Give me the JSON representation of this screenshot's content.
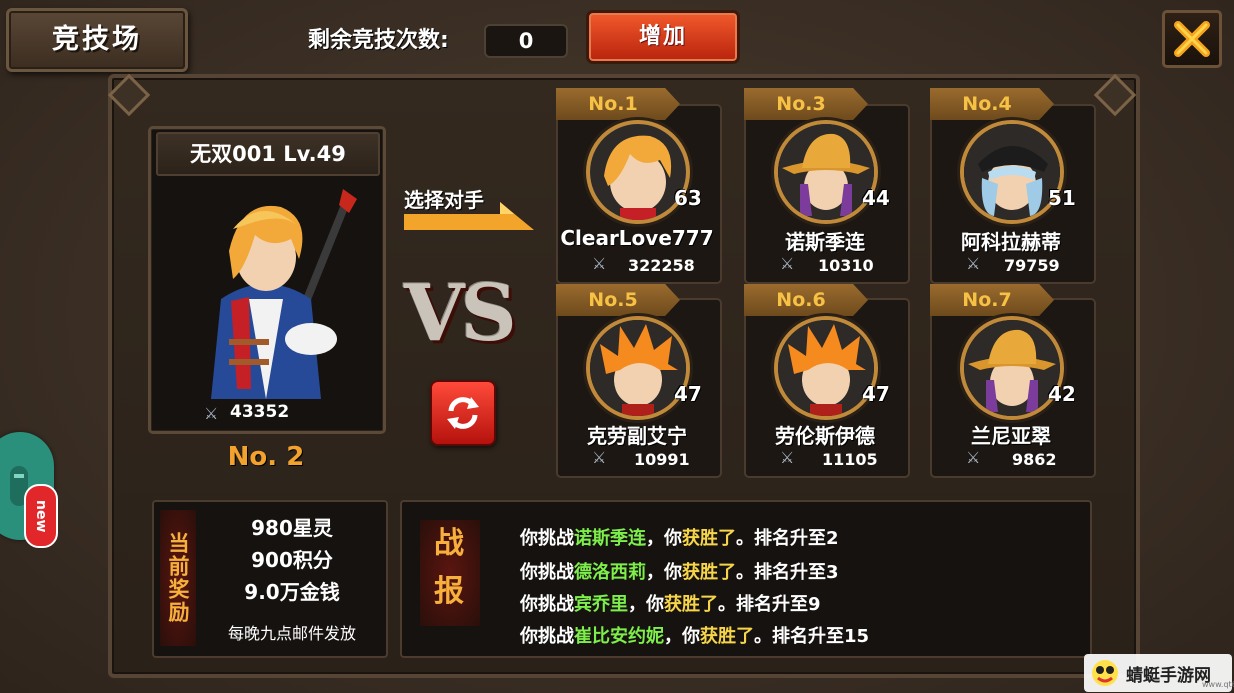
{
  "header": {
    "title": "竞技场",
    "remaining_label": "剩余竞技次数:",
    "remaining_value": "0",
    "add_button": "增加",
    "close_icon": "close-x-icon"
  },
  "player": {
    "name_level": "无双001 Lv.49",
    "power": "43352",
    "rank": "No. 2"
  },
  "center": {
    "select_label": "选择对手",
    "vs": "VS",
    "refresh_icon": "refresh-icon"
  },
  "opponents": [
    {
      "rank": "No.1",
      "level": "63",
      "name": "ClearLove777",
      "power": "322258"
    },
    {
      "rank": "No.3",
      "level": "44",
      "name": "诺斯季连",
      "power": "10310"
    },
    {
      "rank": "No.4",
      "level": "51",
      "name": "阿科拉赫蒂",
      "power": "79759"
    },
    {
      "rank": "No.5",
      "level": "47",
      "name": "克劳副艾宁",
      "power": "10991"
    },
    {
      "rank": "No.6",
      "level": "47",
      "name": "劳伦斯伊德",
      "power": "11105"
    },
    {
      "rank": "No.7",
      "level": "42",
      "name": "兰尼亚翠",
      "power": "9862"
    }
  ],
  "rewards": {
    "tag": "当前奖励",
    "lines": [
      "980星灵",
      "900积分",
      "9.0万金钱"
    ],
    "note": "每晚九点邮件发放"
  },
  "battle_report": {
    "tag_line1": "战",
    "tag_line2": "报",
    "entries": [
      {
        "pre": "你挑战",
        "opponent": "诺斯季连",
        "sep": "，你",
        "result": "获胜了",
        "post": "。排名升至2"
      },
      {
        "pre": "你挑战",
        "opponent": "德洛西莉",
        "sep": "，你",
        "result": "获胜了",
        "post": "。排名升至3"
      },
      {
        "pre": "你挑战",
        "opponent": "宾乔里",
        "sep": "，你",
        "result": "获胜了",
        "post": "。排名升至9"
      },
      {
        "pre": "你挑战",
        "opponent": "崔比安约妮",
        "sep": "，你",
        "result": "获胜了",
        "post": "。排名升至15"
      }
    ]
  },
  "side": {
    "new_badge": "new"
  },
  "watermark": {
    "text": "蜻蜓手游网",
    "sub": "www.qt6.com"
  }
}
